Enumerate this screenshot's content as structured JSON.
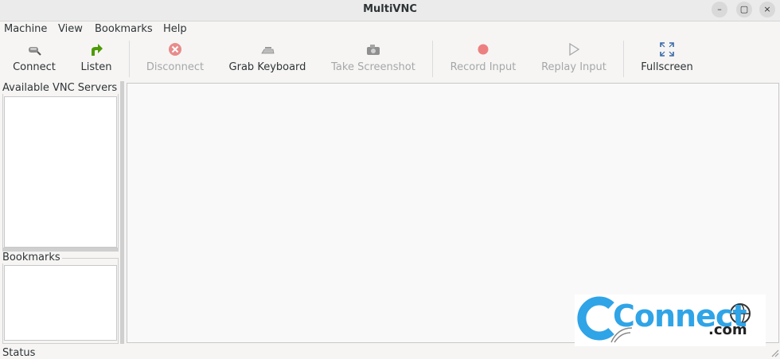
{
  "window": {
    "title": "MultiVNC",
    "controls": {
      "minimize": "–",
      "maximize": "▢",
      "close": "×"
    }
  },
  "menu": {
    "items": [
      "Machine",
      "View",
      "Bookmarks",
      "Help"
    ]
  },
  "toolbar": {
    "connect": "Connect",
    "listen": "Listen",
    "disconnect": "Disconnect",
    "grab_keyboard": "Grab Keyboard",
    "take_screenshot": "Take Screenshot",
    "record_input": "Record Input",
    "replay_input": "Replay Input",
    "fullscreen": "Fullscreen"
  },
  "sidebar": {
    "servers_label": "Available VNC Servers",
    "bookmarks_label": "Bookmarks"
  },
  "status": {
    "text": "Status"
  },
  "watermark": {
    "brand": "Connect",
    "suffix": ".com"
  },
  "colors": {
    "accent_blue": "#2fa4e7",
    "listen_green": "#4e9a06",
    "disabled_red": "#e35d5d"
  }
}
